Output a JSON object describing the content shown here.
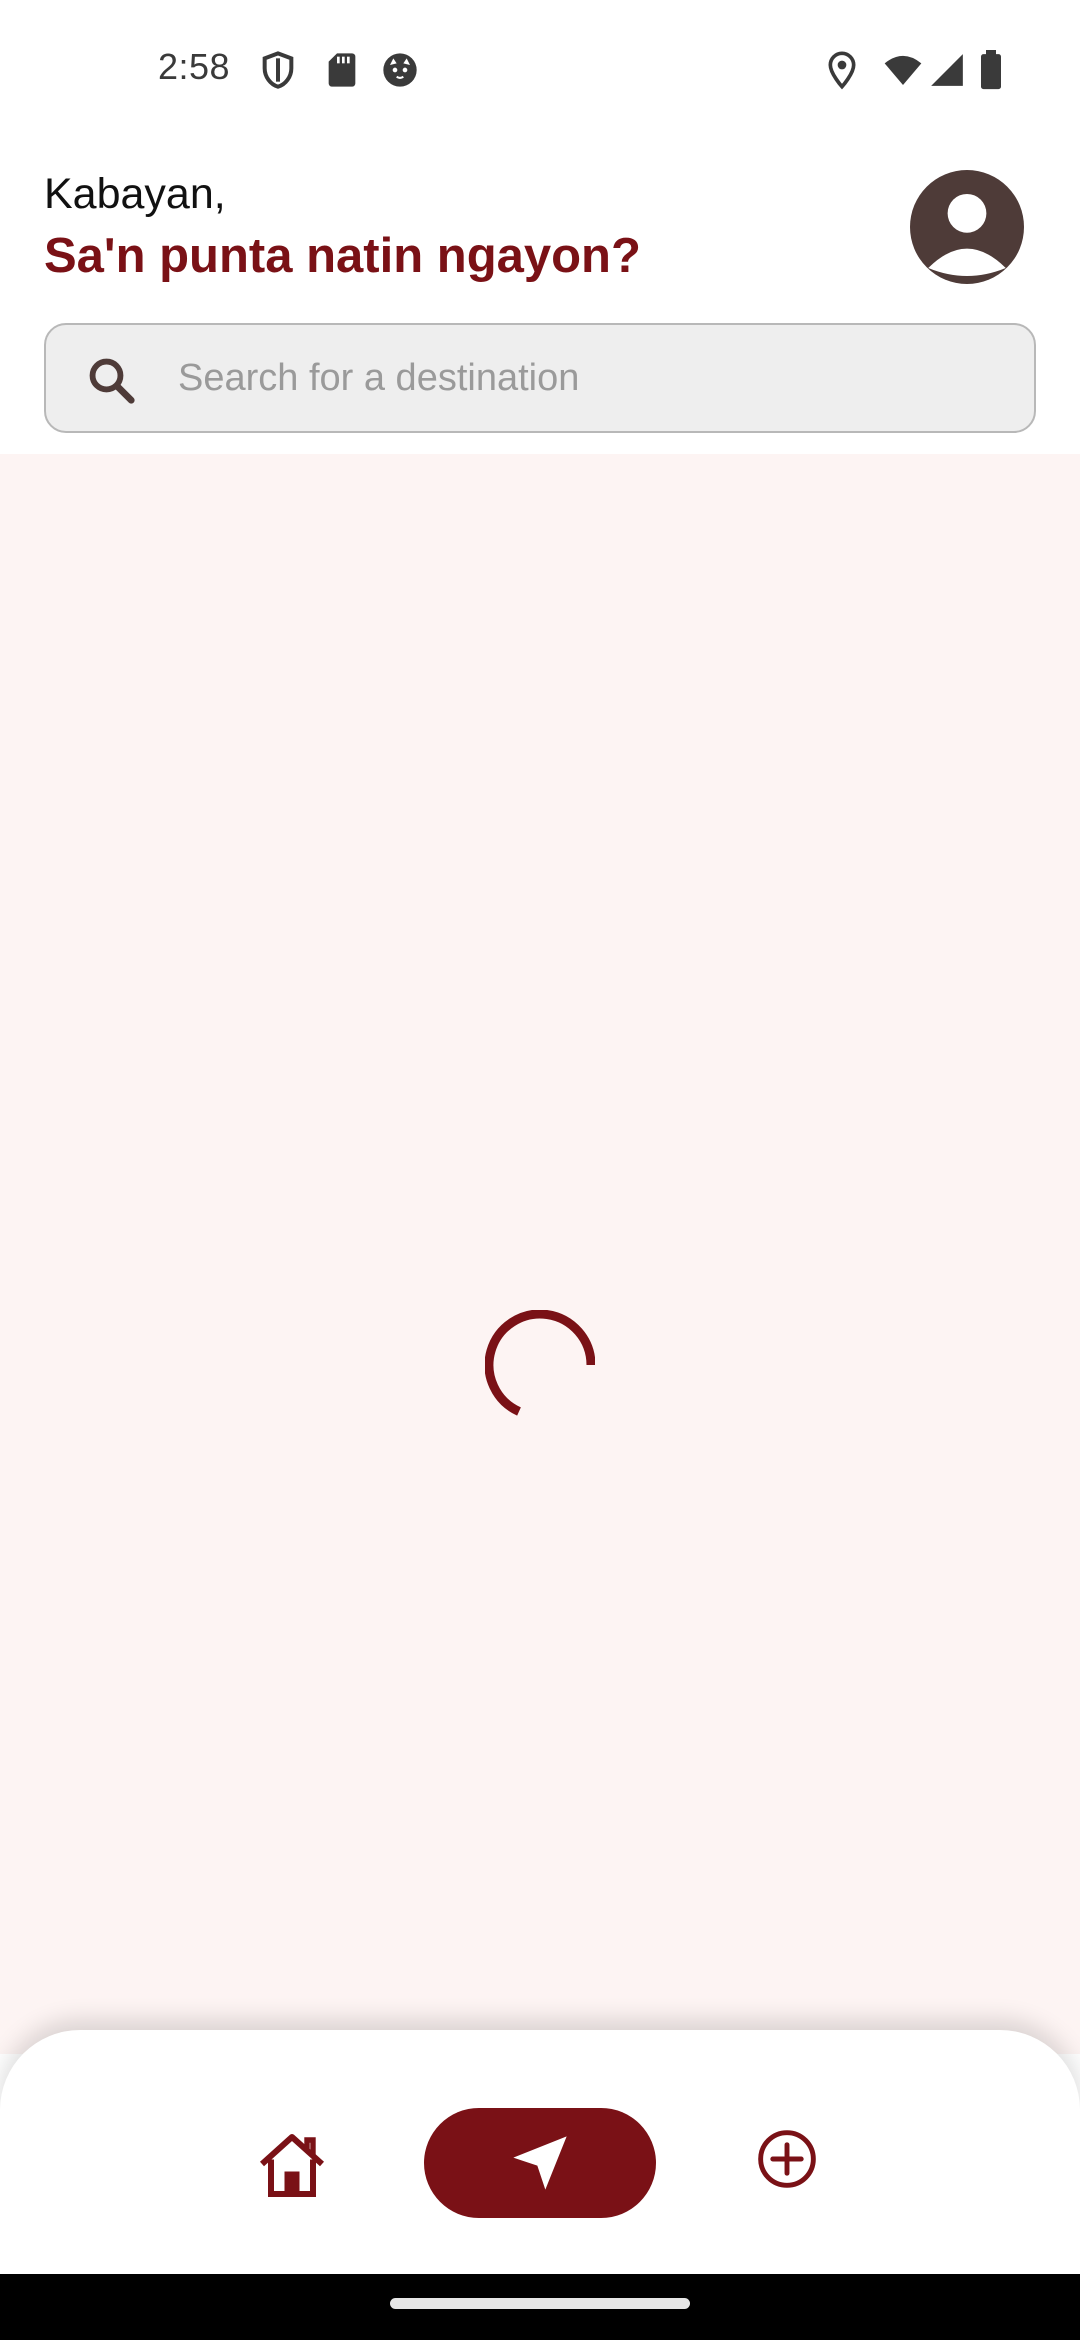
{
  "status_bar": {
    "time": "2:58",
    "left_icons": [
      "shield-icon",
      "sd-card-icon",
      "cat-face-icon"
    ],
    "right_icons": [
      "location-pin-icon",
      "wifi-icon",
      "cellular-signal-icon",
      "battery-icon"
    ]
  },
  "header": {
    "greeting": "Kabayan,",
    "subtitle": "Sa'n punta natin ngayon?",
    "avatar_icon": "account-circle-icon"
  },
  "search": {
    "placeholder": "Search for a destination",
    "value": "",
    "icon": "search-icon"
  },
  "content": {
    "state": "loading",
    "indicator_icon": "loading-spinner-icon"
  },
  "bottom_nav": {
    "items": [
      {
        "icon": "home-icon",
        "active": false
      },
      {
        "icon": "navigation-arrow-icon",
        "active": true
      },
      {
        "icon": "add-circle-icon",
        "active": false
      }
    ]
  },
  "colors": {
    "brand": "#7a1116",
    "content_background": "#fdf4f3",
    "search_background": "#eeeeee",
    "avatar": "#4e3b38"
  }
}
